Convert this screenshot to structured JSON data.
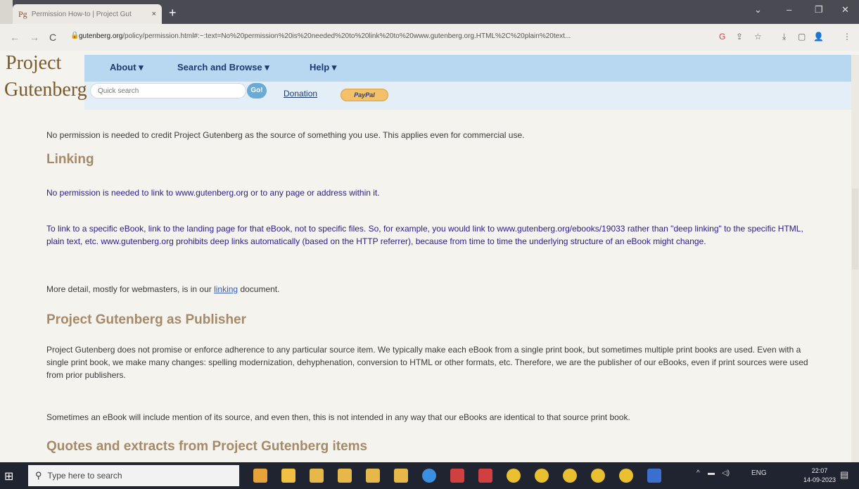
{
  "browser": {
    "tab_title": "Permission How-to | Project Gut",
    "tab_close": "×",
    "favicon": "Pg",
    "new_tab": "+",
    "window_controls": [
      "⌄",
      "–",
      "❐",
      "✕"
    ],
    "url_host": "gutenberg.org",
    "url_path": "/policy/permission.html#:~:text=No%20permission%20is%20needed%20to%20link%20to%20www.gutenberg.org.HTML%2C%20plain%20text...",
    "toolbar_icons": [
      "G",
      "⇪",
      "☆",
      "⤓",
      "▢",
      "👤",
      "⋮"
    ]
  },
  "site": {
    "logo_line1": "Project",
    "logo_line2": "Gutenberg",
    "menu": [
      "About ▾",
      "Search and Browse ▾",
      "Help ▾"
    ],
    "search_placeholder": "Quick search",
    "go_label": "Go!",
    "donation": "Donation",
    "paypal": "PayPal"
  },
  "content": {
    "p_credit": "No permission is needed to credit Project Gutenberg as the source of something you use. This applies even for commercial use.",
    "h_linking": "Linking",
    "p_link1": "No permission is needed to link to www.gutenberg.org or to any page or address within it.",
    "p_link2": "To link to a specific eBook, link to the landing page for that eBook, not to specific files. So, for example, you would link to www.gutenberg.org/ebooks/19033 rather than \"deep linking\" to the specific HTML, plain text, etc. www.gutenberg.org prohibits deep links automatically (based on the HTTP referrer), because from time to time the underlying structure of an eBook might change.",
    "p_detail_pre": "More detail, mostly for webmasters, is in our ",
    "p_detail_link": "linking",
    "p_detail_post": " document.",
    "h_publisher": "Project Gutenberg as Publisher",
    "p_pub1": "Project Gutenberg does not promise or enforce adherence to any particular source item. We typically make each eBook from a single print book, but sometimes multiple print books are used. Even with a single print book, we make many changes: spelling modernization, dehyphenation, conversion to HTML or other formats, etc. Therefore, we are the publisher of our eBooks, even if print sources were used from prior publishers.",
    "p_pub2": "Sometimes an eBook will include mention of its source, and even then, this is not intended in any way that our eBooks are identical to that source print book.",
    "h_quotes": "Quotes and extracts from Project Gutenberg items"
  },
  "taskbar": {
    "search_placeholder": "Type here to search",
    "lang": "ENG",
    "time": "22:07",
    "date": "14-09-2023",
    "app_colors": [
      "#e8a23a",
      "#f0c040",
      "#e6b84a",
      "#e6b84a",
      "#e6b84a",
      "#e6b84a",
      "#3a8fe0",
      "#d04040",
      "#d04040",
      "#e8c030",
      "#e8c030",
      "#e8c030",
      "#e8c030",
      "#e8c030",
      "#3a6fd0"
    ]
  }
}
